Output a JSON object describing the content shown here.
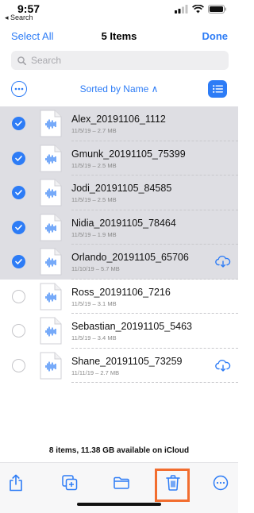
{
  "status_bar": {
    "time": "9:57",
    "back_label": "◂ Search"
  },
  "nav": {
    "select_all": "Select All",
    "title": "5 Items",
    "done": "Done"
  },
  "search": {
    "placeholder": "Search"
  },
  "sort": {
    "label": "Sorted by Name ∧"
  },
  "files": [
    {
      "name": "Alex_20191106_1112",
      "meta": "11/5/19 – 2.7 MB",
      "selected": true,
      "cloud": false
    },
    {
      "name": "Gmunk_20191105_75399",
      "meta": "11/5/19 – 2.5 MB",
      "selected": true,
      "cloud": false
    },
    {
      "name": "Jodi_20191105_84585",
      "meta": "11/5/19 – 2.5 MB",
      "selected": true,
      "cloud": false
    },
    {
      "name": "Nidia_20191105_78464",
      "meta": "11/5/19 – 1.9 MB",
      "selected": true,
      "cloud": false
    },
    {
      "name": "Orlando_20191105_65706",
      "meta": "11/10/19 – 5.7 MB",
      "selected": true,
      "cloud": true
    },
    {
      "name": "Ross_20191106_7216",
      "meta": "11/5/19 – 3.1 MB",
      "selected": false,
      "cloud": false
    },
    {
      "name": "Sebastian_20191105_5463",
      "meta": "11/5/19 – 3.4 MB",
      "selected": false,
      "cloud": false
    },
    {
      "name": "Shane_20191105_73259",
      "meta": "11/11/19 – 2.7 MB",
      "selected": false,
      "cloud": true
    }
  ],
  "footer": {
    "info": "8 items, 11.38 GB available on iCloud"
  },
  "toolbar": {
    "buttons": [
      {
        "name": "share-icon"
      },
      {
        "name": "duplicate-icon"
      },
      {
        "name": "folder-icon"
      },
      {
        "name": "trash-icon",
        "highlighted": true
      },
      {
        "name": "more-icon"
      }
    ]
  },
  "colors": {
    "accent": "#2d7cf6",
    "selected_row": "#dedee3",
    "highlight_box": "#f26d2f"
  }
}
